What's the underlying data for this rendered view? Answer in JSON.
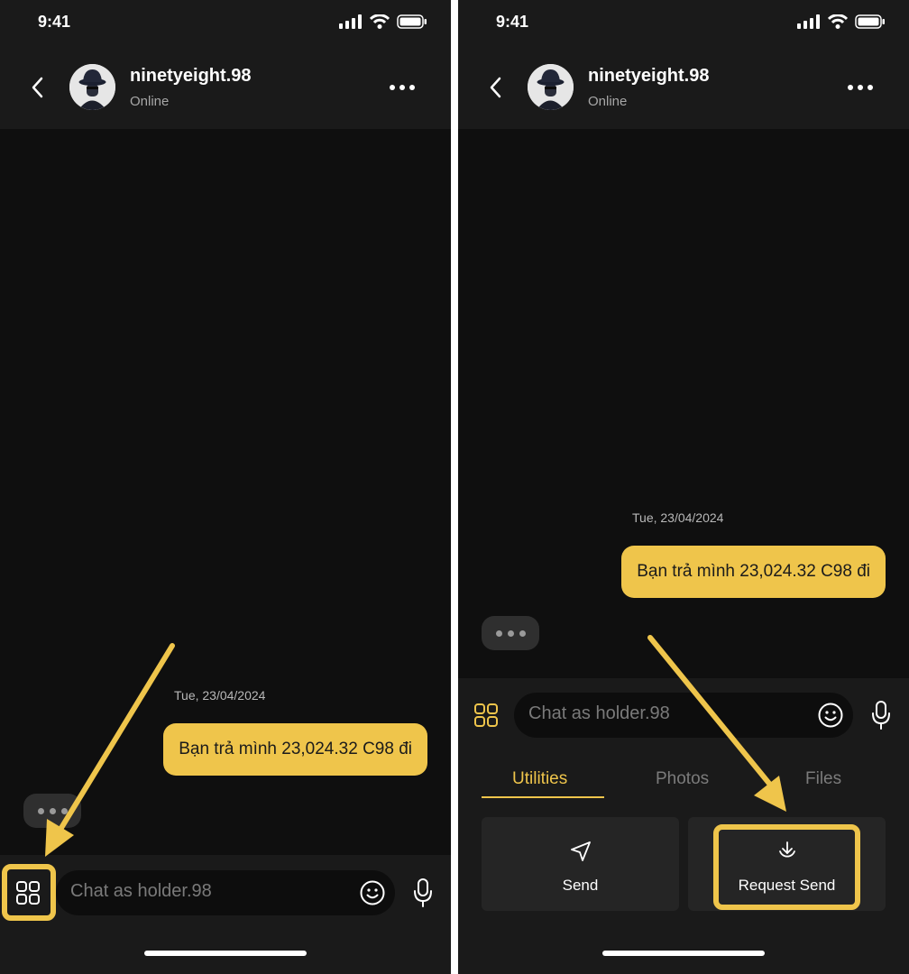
{
  "status": {
    "time": "9:41"
  },
  "header": {
    "username": "ninetyeight.98",
    "presence": "Online"
  },
  "chat": {
    "date": "Tue, 23/04/2024",
    "message": "Bạn trả mình 23,024.32 C98 đi"
  },
  "input": {
    "placeholder": "Chat as holder.98"
  },
  "panel": {
    "tabs": [
      "Utilities",
      "Photos",
      "Files"
    ],
    "actions": [
      {
        "label": "Send",
        "icon": "send-icon"
      },
      {
        "label": "Request Send",
        "icon": "download-icon"
      }
    ]
  },
  "colors": {
    "accent": "#efc54b",
    "background": "#0f0f0f",
    "surface": "#1a1a1a"
  }
}
